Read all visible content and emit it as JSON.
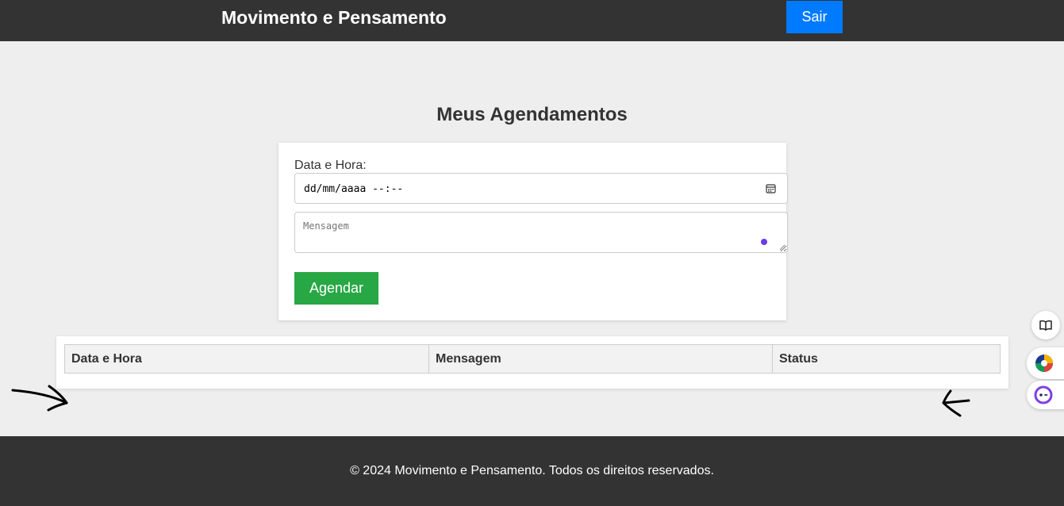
{
  "header": {
    "title": "Movimento e Pensamento",
    "logout_label": "Sair"
  },
  "main": {
    "title": "Meus Agendamentos",
    "form": {
      "datetime_label": "Data e Hora:",
      "datetime_value": "dd/mm/aaaa --:--",
      "message_placeholder": "Mensagem",
      "submit_label": "Agendar"
    },
    "table": {
      "headers": [
        "Data e Hora",
        "Mensagem",
        "Status"
      ]
    }
  },
  "footer": {
    "text": "© 2024 Movimento e Pensamento. Todos os direitos reservados."
  },
  "colors": {
    "header_bg": "#333333",
    "primary_button": "#007bff",
    "submit_button": "#28a745",
    "page_bg": "#eeeeee"
  },
  "icons": {
    "calendar": "calendar-icon",
    "reader": "book-open-icon",
    "extension_one": "color-wheel-icon",
    "extension_two": "assistant-face-icon"
  }
}
